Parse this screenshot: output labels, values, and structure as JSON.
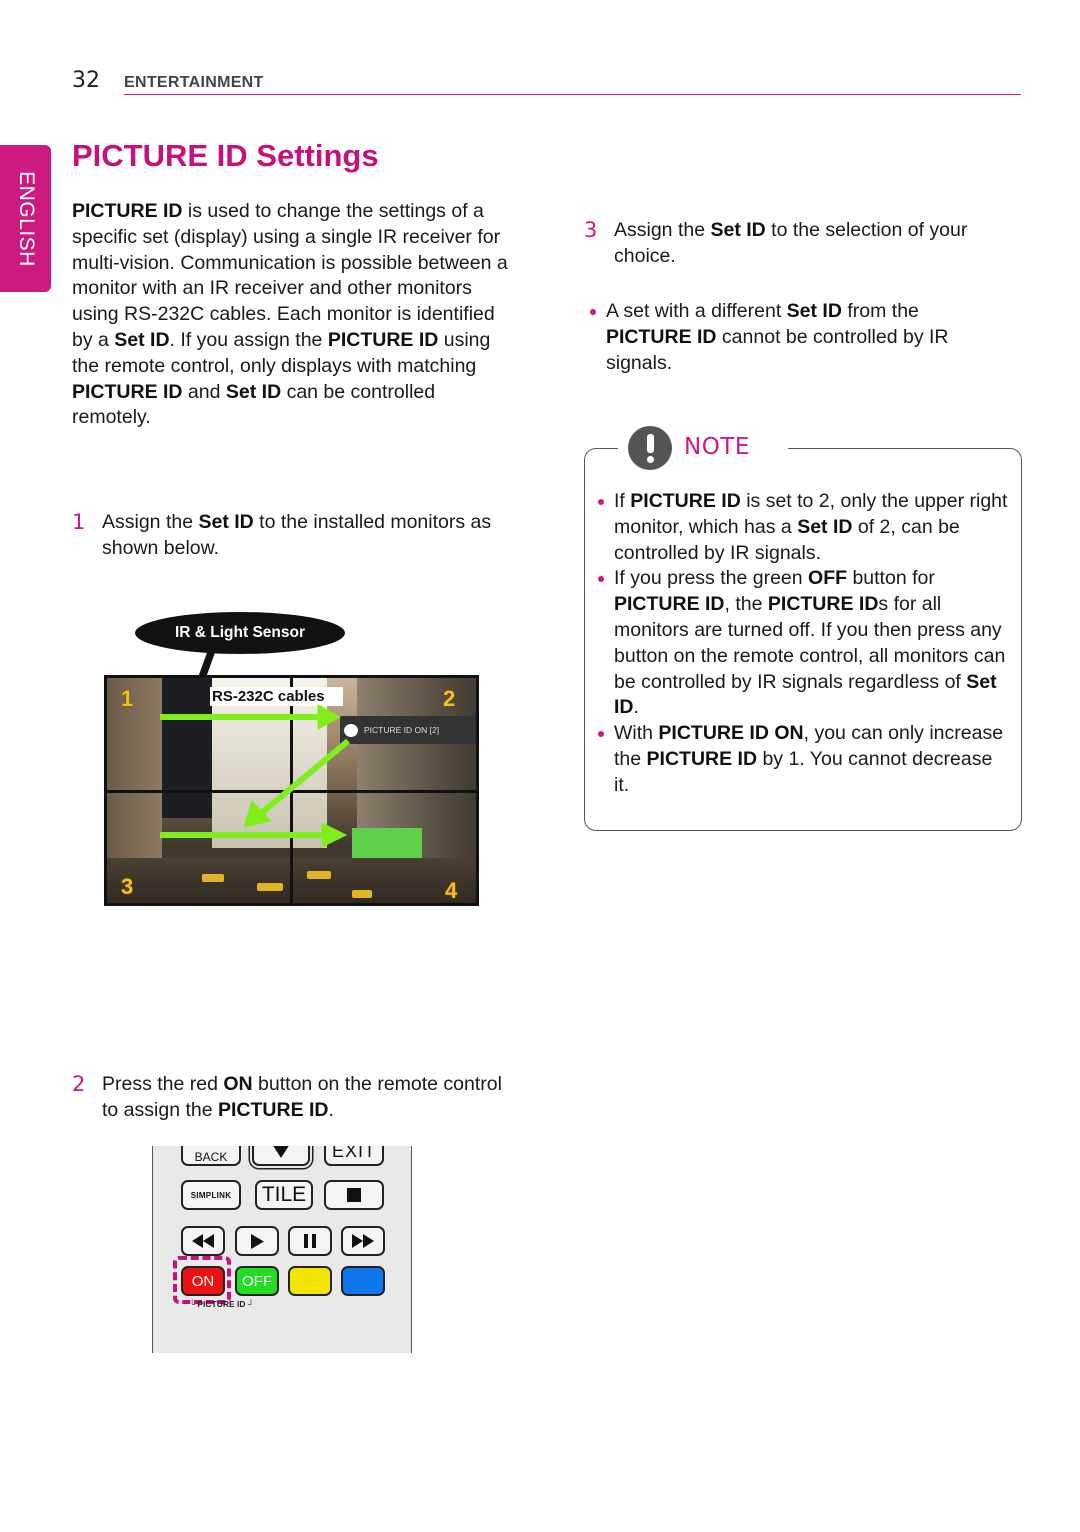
{
  "header": {
    "page_number": "32",
    "section": "ENTERTAINMENT"
  },
  "language_tab": "ENGLISH",
  "title": "PICTURE ID Settings",
  "intro": [
    {
      "t": "PICTURE ID",
      "b": true
    },
    {
      "t": " is used to change the settings of a specific set (display) using a single IR receiver for multi-vision. Communication is possible between a monitor with an IR receiver and other monitors using RS-232C cables. Each monitor is identified by a "
    },
    {
      "t": "Set ID",
      "b": true
    },
    {
      "t": ". If you assign the "
    },
    {
      "t": "PICTURE ID",
      "b": true
    },
    {
      "t": " using the remote control, only displays with matching "
    },
    {
      "t": "PICTURE ID",
      "b": true
    },
    {
      "t": " and "
    },
    {
      "t": "Set ID",
      "b": true
    },
    {
      "t": " can be controlled remotely."
    }
  ],
  "steps": [
    {
      "num": "1",
      "parts": [
        {
          "t": "Assign the "
        },
        {
          "t": "Set ID",
          "b": true
        },
        {
          "t": " to the installed monitors as shown below."
        }
      ]
    },
    {
      "num": "2",
      "parts": [
        {
          "t": "Press the red "
        },
        {
          "t": "ON",
          "b": true
        },
        {
          "t": " button on the remote control to assign the "
        },
        {
          "t": "PICTURE ID",
          "b": true
        },
        {
          "t": "."
        }
      ]
    },
    {
      "num": "3",
      "parts": [
        {
          "t": "Assign the "
        },
        {
          "t": "Set ID",
          "b": true
        },
        {
          "t": " to the selection of your choice."
        }
      ]
    }
  ],
  "step3_bullet": [
    {
      "t": "A set with a different "
    },
    {
      "t": "Set ID",
      "b": true
    },
    {
      "t": " from the "
    },
    {
      "t": "PICTURE ID",
      "b": true
    },
    {
      "t": " cannot be controlled by IR signals."
    }
  ],
  "figure": {
    "sensor_label": "IR & Light Sensor",
    "cables_label": "RS-232C cables",
    "osd_text": "PICTURE ID ON [2]",
    "monitor_numbers": [
      "1",
      "2",
      "3",
      "4"
    ]
  },
  "remote": {
    "back": "BACK",
    "exit": "EXIT",
    "simplink": "SIMPLINK",
    "tile": "TILE",
    "on": "ON",
    "off": "OFF",
    "picture_id_caption": "└ PICTURE ID ┘",
    "colors": {
      "red": "#ee1111",
      "green": "#22dd22",
      "yellow": "#f2e600",
      "blue": "#1177ee"
    }
  },
  "note": {
    "label": "NOTE",
    "items": [
      [
        {
          "t": "If "
        },
        {
          "t": "PICTURE ID",
          "b": true
        },
        {
          "t": " is set to 2, only the upper right monitor, which has a "
        },
        {
          "t": "Set ID",
          "b": true
        },
        {
          "t": " of 2, can be controlled by IR signals."
        }
      ],
      [
        {
          "t": "If you press the green "
        },
        {
          "t": "OFF",
          "b": true
        },
        {
          "t": " button for "
        },
        {
          "t": "PICTURE ID",
          "b": true
        },
        {
          "t": ", the "
        },
        {
          "t": "PICTURE ID",
          "b": true
        },
        {
          "t": "s for all monitors are turned off. If you then press any button on the remote control, all monitors can be controlled by IR signals regardless of "
        },
        {
          "t": "Set ID",
          "b": true
        },
        {
          "t": "."
        }
      ],
      [
        {
          "t": "With "
        },
        {
          "t": "PICTURE ID ON",
          "b": true
        },
        {
          "t": ", you can only increase the "
        },
        {
          "t": "PICTURE ID",
          "b": true
        },
        {
          "t": " by 1. You cannot decrease it."
        }
      ]
    ]
  },
  "colors": {
    "accent": "#c6117d",
    "bullet": "#d0197f"
  }
}
